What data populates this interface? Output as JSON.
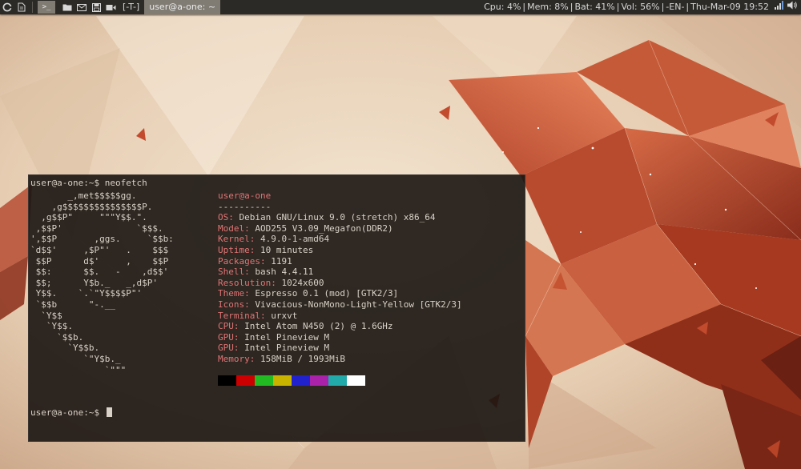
{
  "panel": {
    "layout_indicator": "[-T-]",
    "window_title": "user@a-one: ~",
    "status": {
      "cpu": "Cpu: 4%",
      "mem": "Mem: 8%",
      "bat": "Bat: 41%",
      "vol": "Vol: 56%",
      "lang": "-EN-",
      "clock": "Thu-Mar-09 19:52",
      "divider": " | "
    },
    "icons": [
      "debian-swirl-icon",
      "document-icon",
      "terminal-icon",
      "folder-icon",
      "mail-icon",
      "save-icon",
      "video-icon",
      "signal-icon",
      "speaker-icon"
    ]
  },
  "terminal": {
    "prompt_top": "user@a-one:~$ neofetch",
    "ascii_logo": "       _,met$$$$$gg.\n    ,g$$$$$$$$$$$$$$$P.\n  ,g$$P\"     \"\"\"Y$$.\".\n ,$$P'              `$$$.\n',$$P       ,ggs.     `$$b:\n`d$$'     ,$P\"'   .    $$$\n $$P      d$'     ,    $$P\n $$:      $$.   -    ,d$$'\n $$;      Y$b._   _,d$P'\n Y$$.    `.`\"Y$$$$P\"'\n `$$b      \"-.__\n  `Y$$\n   `Y$$.\n     `$$b.\n       `Y$$b.\n          `\"Y$b._\n              `\"\"\"",
    "user_host": "user@a-one",
    "underline": "----------",
    "info": [
      {
        "key": "OS",
        "value": "Debian GNU/Linux 9.0 (stretch) x86_64"
      },
      {
        "key": "Model",
        "value": "AOD255 V3.09_Megafon(DDR2)"
      },
      {
        "key": "Kernel",
        "value": "4.9.0-1-amd64"
      },
      {
        "key": "Uptime",
        "value": "10 minutes"
      },
      {
        "key": "Packages",
        "value": "1191"
      },
      {
        "key": "Shell",
        "value": "bash 4.4.11"
      },
      {
        "key": "Resolution",
        "value": "1024x600"
      },
      {
        "key": "Theme",
        "value": "Espresso 0.1 (mod) [GTK2/3]"
      },
      {
        "key": "Icons",
        "value": "Vivacious-NonMono-Light-Yellow [GTK2/3]"
      },
      {
        "key": "Terminal",
        "value": "urxvt"
      },
      {
        "key": "CPU",
        "value": "Intel Atom N450 (2) @ 1.6GHz"
      },
      {
        "key": "GPU",
        "value": "Intel Pineview M"
      },
      {
        "key": "GPU",
        "value": "Intel Pineview M"
      },
      {
        "key": "Memory",
        "value": "158MiB / 1993MiB"
      }
    ],
    "palette": [
      "#000000",
      "#cc0000",
      "#22bb22",
      "#c8b400",
      "#2222cc",
      "#aa22aa",
      "#22aaaa",
      "#ffffff"
    ],
    "prompt_bottom": "user@a-one:~$ "
  },
  "colors": {
    "panel_bg": "#2c2a26",
    "accent_red": "#e07474",
    "terminal_fg": "#d9d2c8"
  }
}
